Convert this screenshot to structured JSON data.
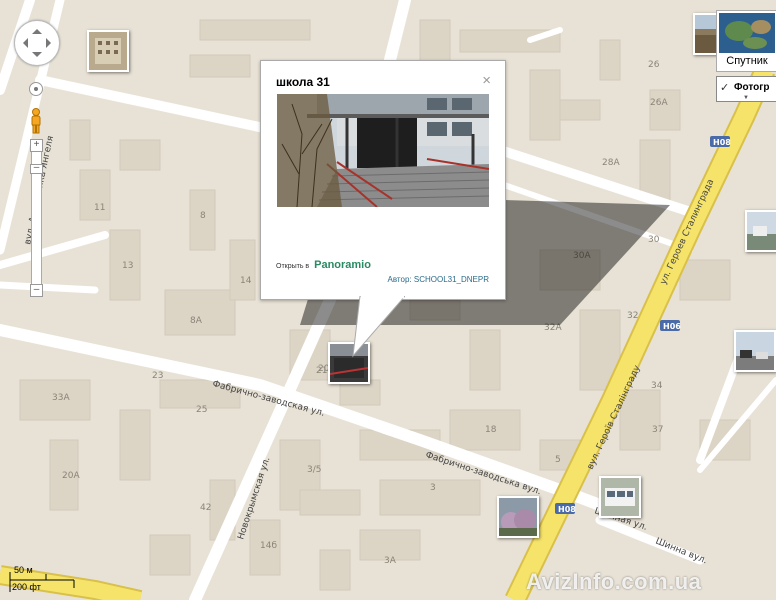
{
  "popup": {
    "title": "школа 31",
    "close_symbol": "×",
    "open_prefix": "Открыть в",
    "service_logo": "Panoramio",
    "author_prefix": "Автор:",
    "author_name": "SCHOOL31_DNEPR"
  },
  "map_type": {
    "satellite_label": "Спутник",
    "photos_layer_label": "Фотогр",
    "photos_layer_checked": true
  },
  "scale": {
    "metric": "50 м",
    "imperial": "200 фт"
  },
  "streets": {
    "akademika_yangelya": "вул. Академика Янгеля",
    "fabrichno_zavodskaya": "Фабрично-заводская ул.",
    "fabrichno_zavodska": "Фабрично-заводська вул.",
    "novokrymskaya": "Новокрымская ул.",
    "geroev_stalingrada_ru": "ул. Героев Сталинграда",
    "geroyiv_stalingrada_ua": "вул. Героїв Сталінграду",
    "shinnaya_ru": "Шинная ул.",
    "shinna_ua": "Шинна вул."
  },
  "route_badges": [
    "Н08",
    "Н06",
    "Н08",
    "Н06"
  ],
  "building_numbers": [
    "26",
    "26А",
    "28А",
    "30",
    "30А",
    "32",
    "32А",
    "34",
    "37",
    "18",
    "20А",
    "21",
    "23",
    "25",
    "3/5",
    "3",
    "3А",
    "5",
    "11",
    "13",
    "8",
    "8А",
    "14",
    "14б",
    "20",
    "33А",
    "42"
  ],
  "watermark": "AvizInfo.com.ua",
  "colors": {
    "land": "#e8e2d6",
    "road": "#ffffff",
    "highway": "#f6e46a",
    "highway_edge": "#d9c04a",
    "route_badge": "#4a6aa8"
  }
}
